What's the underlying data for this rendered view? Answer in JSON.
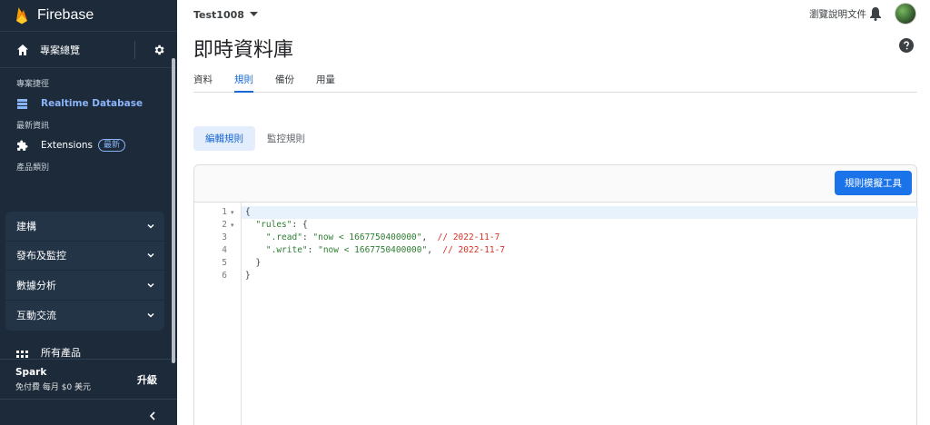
{
  "sidebar": {
    "brand": "Firebase",
    "overview_label": "專案總覽",
    "section_shortcuts": "專案捷徑",
    "realtime_db": "Realtime Database",
    "section_news": "最新資訊",
    "extensions": "Extensions",
    "extensions_badge": "最新",
    "section_categories": "產品類別",
    "groups": [
      {
        "label": "建構"
      },
      {
        "label": "發布及監控"
      },
      {
        "label": "數據分析"
      },
      {
        "label": "互動交流"
      }
    ],
    "all_products": "所有產品",
    "plan_name": "Spark",
    "plan_desc": "免付費 每月 $0 美元",
    "upgrade": "升級"
  },
  "header": {
    "project": "Test1008",
    "docs_link": "瀏覽說明文件"
  },
  "page": {
    "title": "即時資料庫",
    "tabs": [
      "資料",
      "規則",
      "備份",
      "用量"
    ],
    "active_tab": "規則",
    "subtabs": [
      "編輯規則",
      "監控規則"
    ],
    "simulator_button": "規則模擬工具"
  },
  "editor": {
    "line_numbers": [
      "1",
      "2",
      "3",
      "4",
      "5",
      "6"
    ],
    "lines": {
      "l1": "{",
      "l2_key": "\"rules\"",
      "l2_rest": ": {",
      "l3_key": "\".read\"",
      "l3_val": "\"now < 1667750400000\"",
      "l3_comment": "// 2022-11-7",
      "l4_key": "\".write\"",
      "l4_val": "\"now < 1667750400000\"",
      "l4_comment": "// 2022-11-7",
      "l5": "}",
      "l6": "}"
    }
  },
  "colors": {
    "sidebar_bg": "#1c2a3a",
    "accent": "#1a73e8",
    "active_tab": "#1967d2",
    "comment": "#d93025",
    "string": "#2e7d32"
  }
}
